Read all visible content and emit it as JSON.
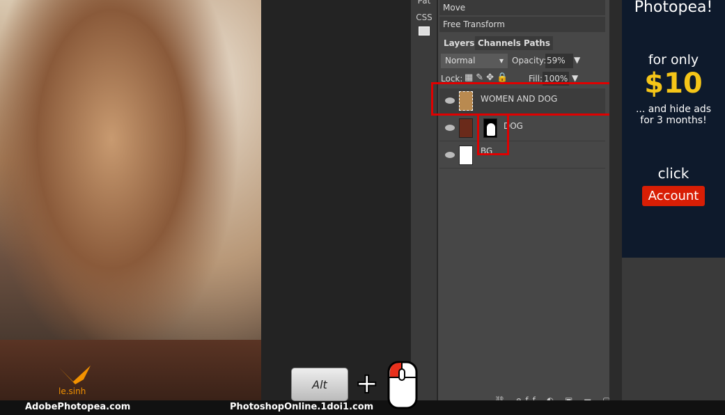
{
  "tools": {
    "top_label": "Pat",
    "css_label": "CSS",
    "image_icon": "image-icon"
  },
  "history": {
    "items": [
      "Move",
      "Free Transform"
    ]
  },
  "tabs": [
    "Layers",
    "Channels",
    "Paths"
  ],
  "blend": {
    "mode": "Normal",
    "opacity_label": "Opacity:",
    "opacity": "59%",
    "lock_label": "Lock:",
    "fill_label": "Fill:",
    "fill": "100%"
  },
  "layers": [
    {
      "name": "WOMEN AND DOG",
      "selected": true
    },
    {
      "name": "DOG",
      "has_mask": true
    },
    {
      "name": "BG"
    }
  ],
  "ad": {
    "title": "Photopea!",
    "line1": "for only",
    "price": "$10",
    "line2": "... and hide ads",
    "line3": "for 3 months!",
    "click": "click",
    "button": "Account",
    "price_color": "#f5c518",
    "button_color": "#d81e05"
  },
  "overlay": {
    "key": "Alt",
    "plus": "+",
    "watermark": "le.sinh"
  },
  "footer": {
    "left": "AdobePhotopea.com",
    "right": "PhotoshopOnline.1doi1.com"
  },
  "colors": {
    "highlight": "#e00000",
    "panel": "#474747"
  }
}
